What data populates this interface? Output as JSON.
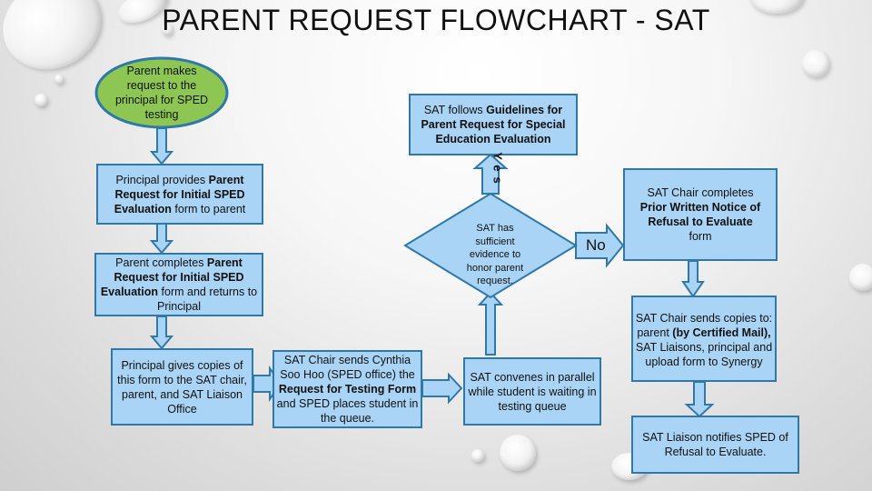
{
  "title": "PARENT REQUEST FLOWCHART - SAT",
  "nodes": {
    "parent_request": {
      "shape": "oval",
      "text": "Parent makes request to the principal for SPED testing",
      "fill": "#8dc653"
    },
    "guidelines": {
      "pre": "SAT follows ",
      "bold": "Guidelines for Parent Request for Special Education Evaluation"
    },
    "principal_provides": {
      "pre": "Principal provides ",
      "bold": "Parent Request for Initial SPED Evaluation",
      "post": " form to parent"
    },
    "parent_completes": {
      "pre": "Parent completes ",
      "bold": "Parent Request for Initial SPED Evaluation",
      "post": " form and returns  to Principal"
    },
    "principal_gives": {
      "text": "Principal gives copies of this form to the SAT chair, parent, and SAT Liaison Office"
    },
    "chair_sends_cynthia": {
      "pre": "SAT Chair sends Cynthia Soo Hoo (SPED office) the ",
      "bold": "Request for Testing Form",
      "post": " and SPED places student in the queue."
    },
    "decision": {
      "shape": "diamond",
      "text": "SAT has sufficient evidence to honor parent request."
    },
    "sat_convenes": {
      "text": "SAT convenes in parallel while student is waiting in testing queue"
    },
    "prior_written_notice": {
      "pre": "SAT Chair completes ",
      "bold": "Prior Written Notice of Refusal to Evaluate",
      "post": " form"
    },
    "chair_sends_copies": {
      "pre": "SAT Chair sends copies to: parent ",
      "bold": "(by Certified Mail),",
      "post": " SAT Liaisons, principal and upload form to Synergy"
    },
    "liaison_notifies": {
      "text": "SAT Liaison notifies SPED of Refusal to Evaluate."
    }
  },
  "edge_labels": {
    "yes": "Yes",
    "no": "No"
  },
  "colors": {
    "box_fill": "#a9d4f5",
    "box_border": "#2f78a8",
    "oval_fill": "#8dc653",
    "oval_border": "#2f78a8"
  }
}
